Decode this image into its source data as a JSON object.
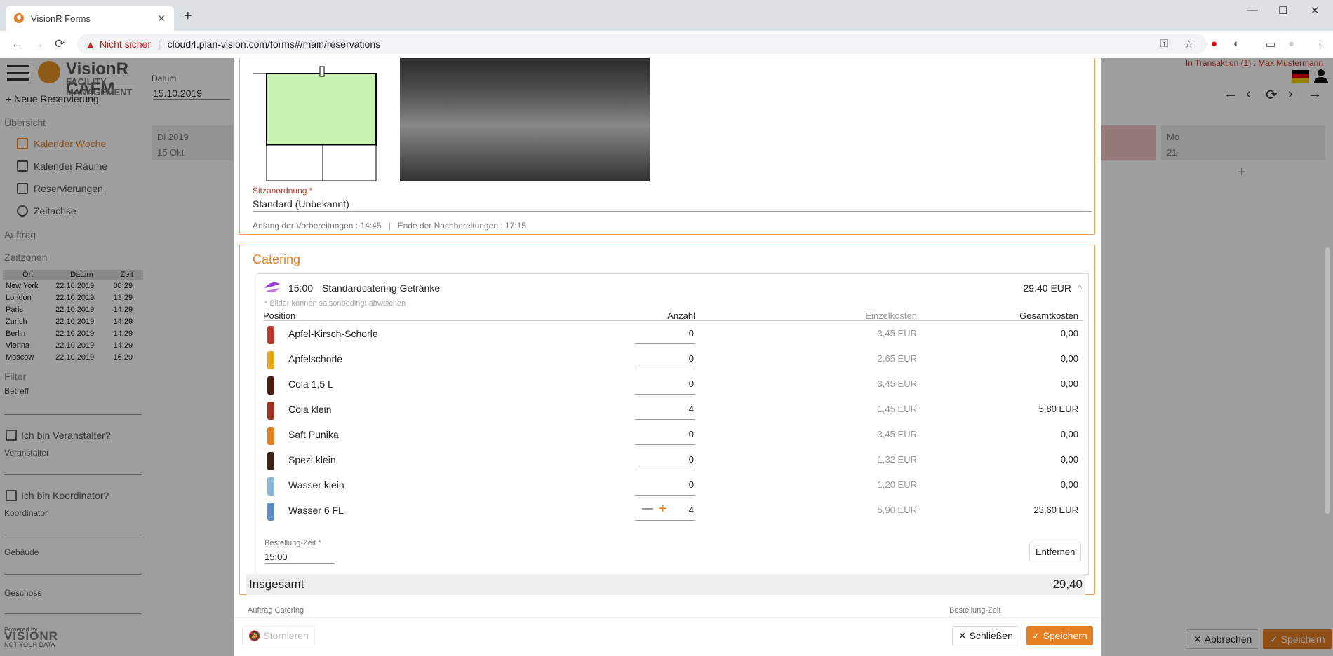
{
  "browser": {
    "tab_title": "VisionR Forms",
    "security": "Nicht sicher",
    "url": "cloud4.plan-vision.com/forms#/main/reservations"
  },
  "app": {
    "brand_title": "VisionR CAFM",
    "brand_sub": "FACILITY MANAGEMENT",
    "transaction_info": "In Transaktion (1) : Max Mustermann",
    "new_reservation": "Neue Reservierung",
    "overview": "Übersicht",
    "nav": [
      "Kalender Woche",
      "Kalender Räume",
      "Reservierungen",
      "Zeitachse"
    ],
    "auftrag": "Auftrag",
    "zeitzonen": "Zeitzonen",
    "tz_headers": [
      "Ort",
      "Datum",
      "Zeit"
    ],
    "tz_rows": [
      [
        "New York",
        "22.10.2019",
        "08:29"
      ],
      [
        "London",
        "22.10.2019",
        "13:29"
      ],
      [
        "Paris",
        "22.10.2019",
        "14:29"
      ],
      [
        "Zurich",
        "22.10.2019",
        "14:29"
      ],
      [
        "Berlin",
        "22.10.2019",
        "14:29"
      ],
      [
        "Vienna",
        "22.10.2019",
        "14:29"
      ],
      [
        "Moscow",
        "22.10.2019",
        "16:29"
      ]
    ],
    "filter": "Filter",
    "betreff": "Betreff",
    "veranstalter_q": "Ich bin Veranstalter?",
    "veranstalter": "Veranstalter",
    "koordinator_q": "Ich bin Koordinator?",
    "koordinator": "Koordinator",
    "gebaeude": "Gebäude",
    "geschoss": "Geschoss",
    "powered_by": "Powered by",
    "powered_brand": "VISIONR",
    "powered_tag": "NOT YOUR DATA",
    "datum_label": "Datum",
    "datum_value": "15.10.2019",
    "day_left_1": "Di 2019",
    "day_left_2": "15 Okt",
    "day_right_1": "Mo",
    "day_right_2": "21",
    "abbrechen": "Abbrechen",
    "speichern": "Speichern"
  },
  "modal": {
    "sitz_label": "Sitzanordnung *",
    "sitz_value": "Standard (Unbekannt)",
    "prep_info": "Anfang der Vorbereitungen : 14:45   |   Ende der Nachbereitungen : 17:15",
    "catering_title": "Catering",
    "card_time": "15:00",
    "card_name": "Standardcatering Getränke",
    "card_price": "29,40 EUR",
    "hint": "* Bilder können saisonbedingt abweichen",
    "headers": [
      "Position",
      "Anzahl",
      "Einzelkosten",
      "Gesamtkosten"
    ],
    "items": [
      {
        "name": "Apfel-Kirsch-Schorle",
        "qty": "0",
        "unit": "3,45 EUR",
        "total": "0,00",
        "color": "#c0392b"
      },
      {
        "name": "Apfelschorle",
        "qty": "0",
        "unit": "2,65 EUR",
        "total": "0,00",
        "color": "#e6a817"
      },
      {
        "name": "Cola 1,5 L",
        "qty": "0",
        "unit": "3,45 EUR",
        "total": "0,00",
        "color": "#4a1c10"
      },
      {
        "name": "Cola klein",
        "qty": "4",
        "unit": "1,45 EUR",
        "total": "5,80 EUR",
        "color": "#a0311f"
      },
      {
        "name": "Saft Punika",
        "qty": "0",
        "unit": "3,45 EUR",
        "total": "0,00",
        "color": "#e67e22"
      },
      {
        "name": "Spezi klein",
        "qty": "0",
        "unit": "1,32 EUR",
        "total": "0,00",
        "color": "#3b2314"
      },
      {
        "name": "Wasser klein",
        "qty": "0",
        "unit": "1,20 EUR",
        "total": "0,00",
        "color": "#8ab4d8"
      },
      {
        "name": "Wasser 6 FL",
        "qty": "4",
        "unit": "5,90 EUR",
        "total": "23,60 EUR",
        "color": "#5b8ec4"
      }
    ],
    "order_time_label": "Bestellung-Zeit *",
    "order_time_value": "15:00",
    "remove": "Entfernen",
    "sum_label": "Insgesamt",
    "sum_value": "29,40",
    "auftrag_catering": "Auftrag Catering",
    "bestell_zeit": "Bestellung-Zeit",
    "stornieren": "Stornieren",
    "schliessen": "Schließen",
    "speichern": "Speichern"
  }
}
